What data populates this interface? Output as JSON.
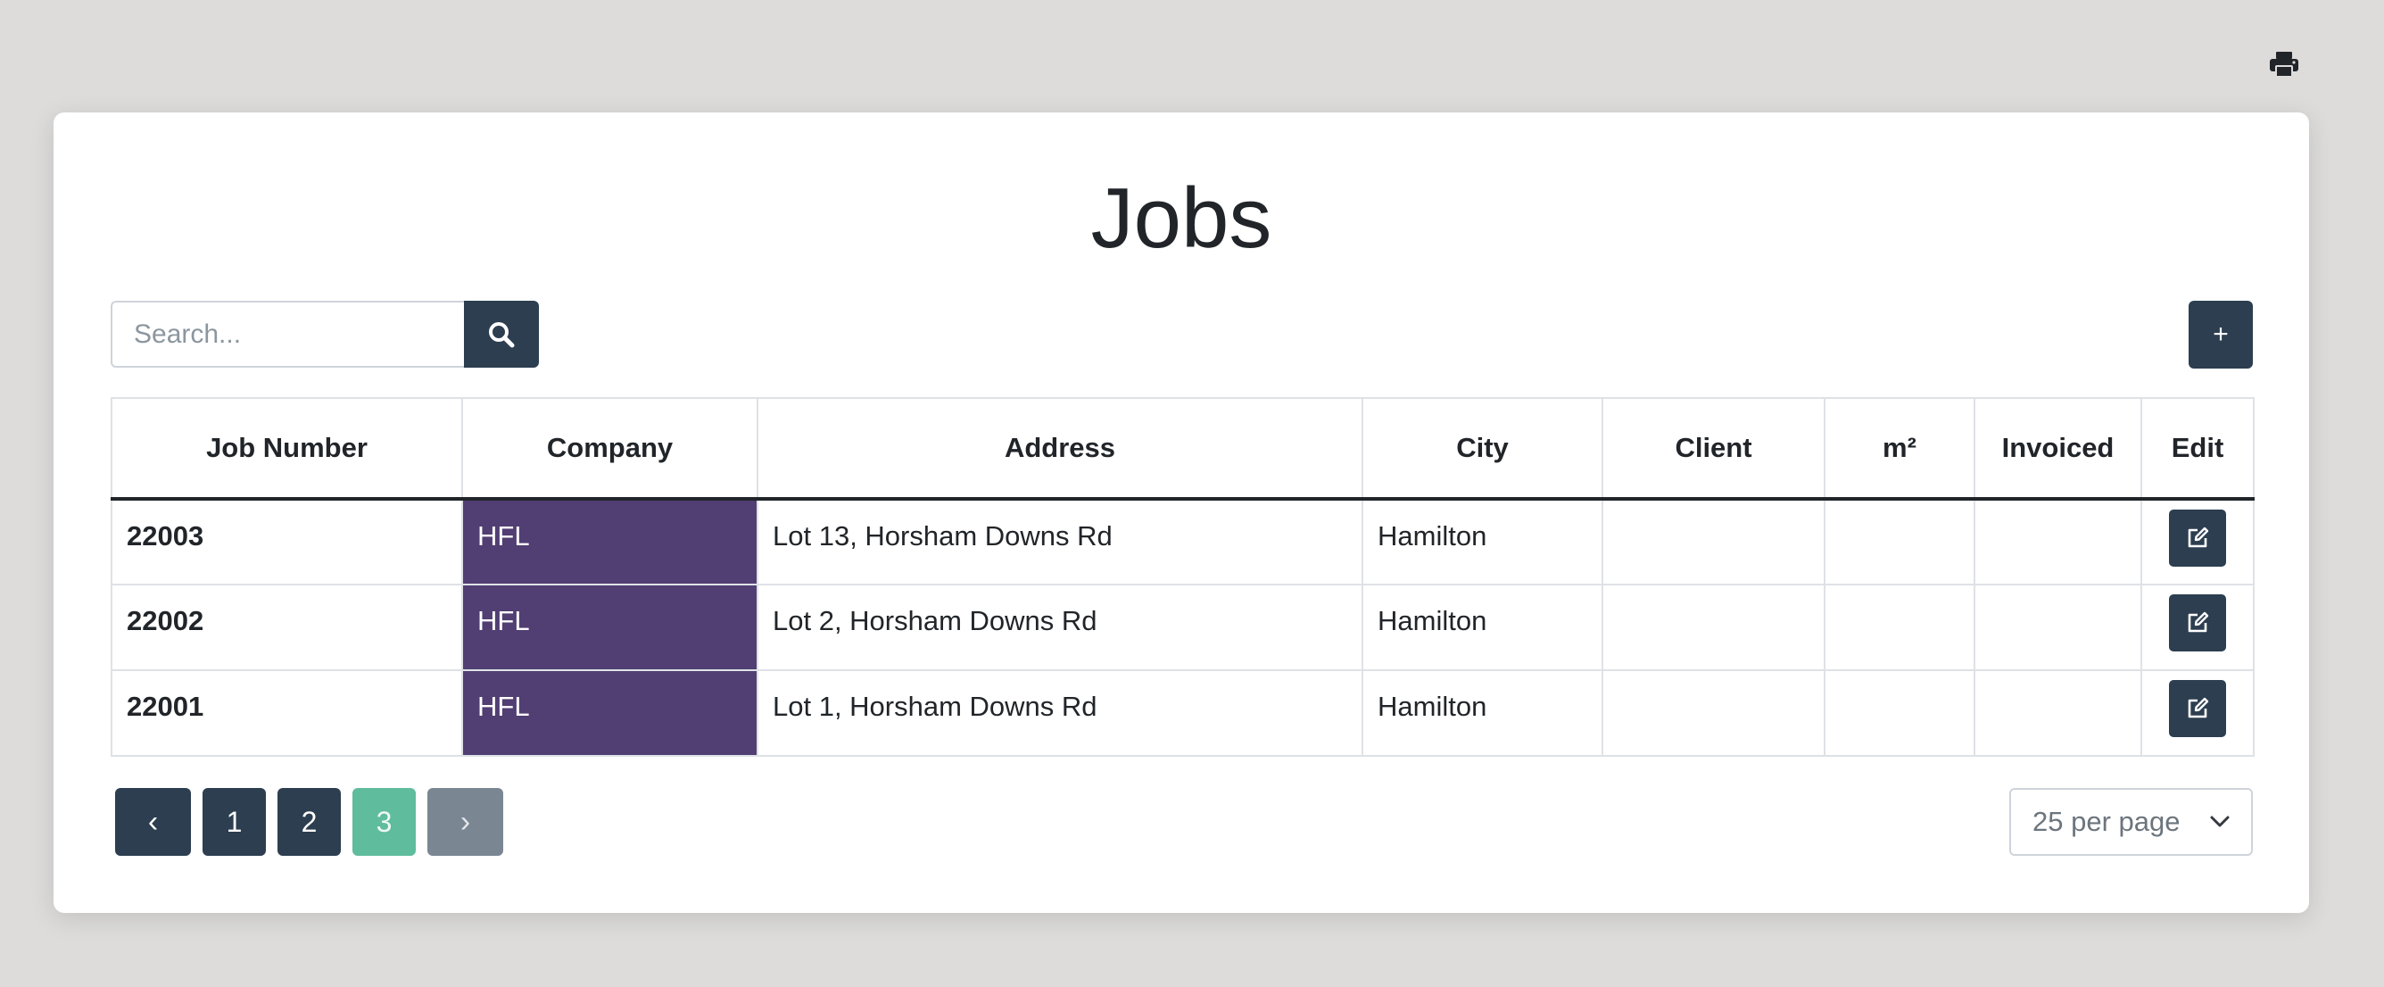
{
  "page": {
    "title": "Jobs",
    "background": "#dddcdb",
    "accent": "#2c3e50",
    "active_page_color": "#5fbc9c",
    "company_color": "#513e73"
  },
  "toolbar": {
    "print_icon": "printer-icon",
    "search_placeholder": "Search...",
    "search_value": "",
    "search_icon": "search-icon",
    "add_label": "+"
  },
  "table": {
    "headers": {
      "job_number": "Job Number",
      "company": "Company",
      "address": "Address",
      "city": "City",
      "client": "Client",
      "area": "m²",
      "invoiced": "Invoiced",
      "edit": "Edit"
    },
    "rows": [
      {
        "job_number": "22003",
        "company": "HFL",
        "address": "Lot 13, Horsham Downs Rd",
        "city": "Hamilton",
        "client": "",
        "area": "",
        "invoiced": "",
        "edit_icon": "edit-icon"
      },
      {
        "job_number": "22002",
        "company": "HFL",
        "address": "Lot 2, Horsham Downs Rd",
        "city": "Hamilton",
        "client": "",
        "area": "",
        "invoiced": "",
        "edit_icon": "edit-icon"
      },
      {
        "job_number": "22001",
        "company": "HFL",
        "address": "Lot 1, Horsham Downs Rd",
        "city": "Hamilton",
        "client": "",
        "area": "",
        "invoiced": "",
        "edit_icon": "edit-icon"
      }
    ]
  },
  "pagination": {
    "prev_label": "‹",
    "pages": [
      "1",
      "2",
      "3"
    ],
    "current_page": "3",
    "next_label": "›",
    "per_page": "25 per page"
  }
}
